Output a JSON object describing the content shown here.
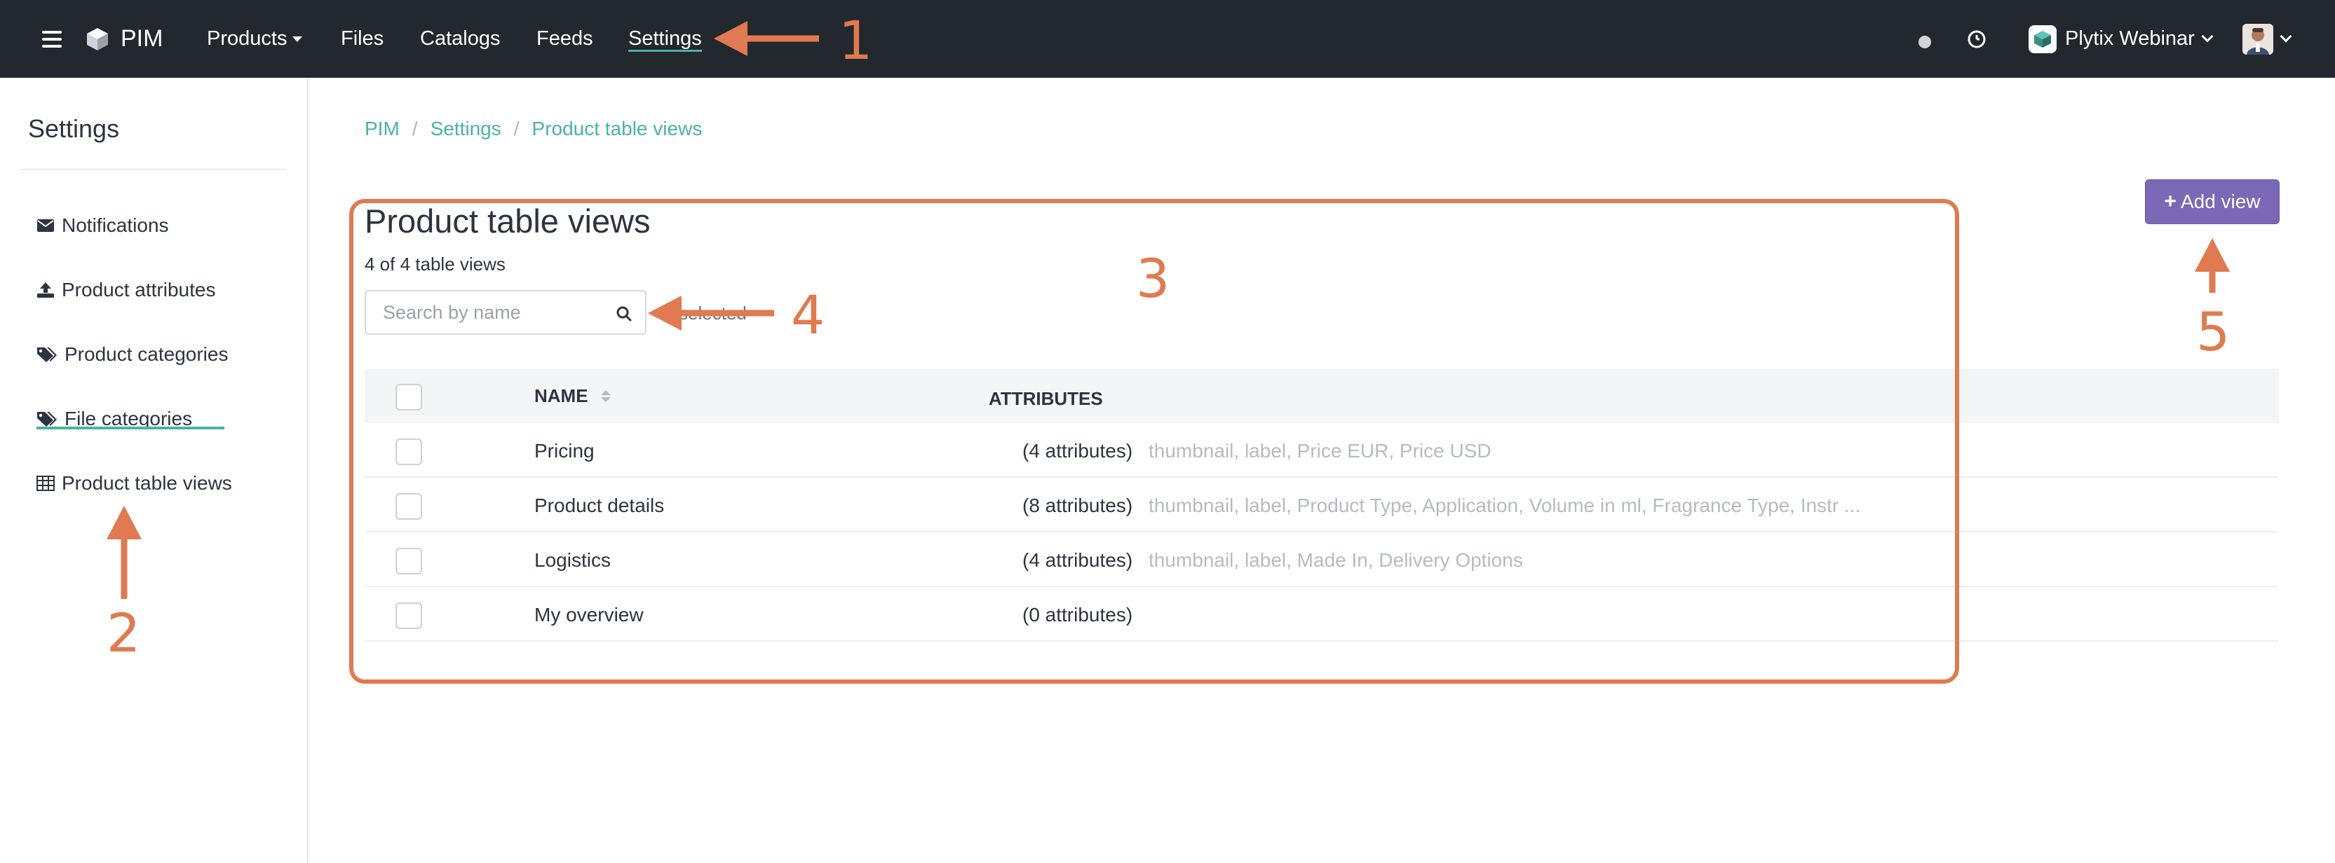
{
  "topbar": {
    "app_name": "PIM",
    "nav": {
      "products": "Products",
      "files": "Files",
      "catalogs": "Catalogs",
      "feeds": "Feeds",
      "settings": "Settings"
    },
    "workspace": "Plytix Webinar"
  },
  "sidebar": {
    "title": "Settings",
    "items": [
      {
        "label": "Notifications",
        "icon": "envelope-icon"
      },
      {
        "label": "Product attributes",
        "icon": "upload-icon"
      },
      {
        "label": "Product categories",
        "icon": "tags-icon"
      },
      {
        "label": "File categories",
        "icon": "tags-icon"
      },
      {
        "label": "Product table views",
        "icon": "table-icon",
        "active": true
      }
    ]
  },
  "breadcrumb": [
    "PIM",
    "Settings",
    "Product table views"
  ],
  "main": {
    "title": "Product table views",
    "count_text": "4 of 4 table views",
    "search_placeholder": "Search by name",
    "selected_text": "selected",
    "add_button": "Add view"
  },
  "table": {
    "headers": {
      "name": "NAME",
      "attributes": "ATTRIBUTES"
    },
    "rows": [
      {
        "name": "Pricing",
        "count": "(4 attributes)",
        "list": "thumbnail, label, Price EUR, Price USD"
      },
      {
        "name": "Product details",
        "count": "(8 attributes)",
        "list": "thumbnail, label, Product Type, Application, Volume in ml, Fragrance Type, Instr ..."
      },
      {
        "name": "Logistics",
        "count": "(4 attributes)",
        "list": "thumbnail, label, Made In, Delivery Options"
      },
      {
        "name": "My overview",
        "count": "(0 attributes)",
        "list": ""
      }
    ]
  },
  "annotations": {
    "n1": "1",
    "n2": "2",
    "n3": "3",
    "n4": "4",
    "n5": "5",
    "color": "#e07a50"
  },
  "colors": {
    "topbar": "#23272e",
    "accent": "#4bb3a3",
    "primary_button": "#7b68b6"
  }
}
